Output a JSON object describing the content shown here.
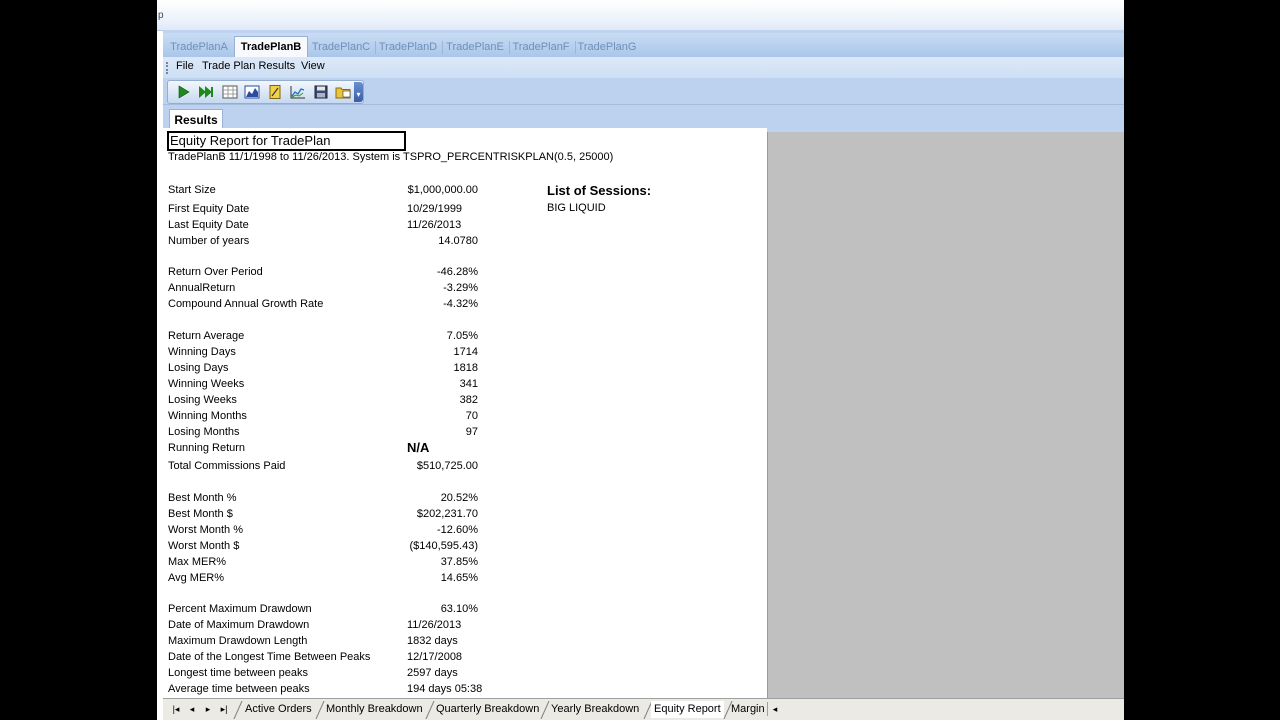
{
  "window": {
    "title_fragment": "p"
  },
  "plan_tabs": [
    {
      "label": "TradePlanA",
      "active": false
    },
    {
      "label": "TradePlanB",
      "active": true
    },
    {
      "label": "TradePlanC",
      "active": false
    },
    {
      "label": "TradePlanD",
      "active": false
    },
    {
      "label": "TradePlanE",
      "active": false
    },
    {
      "label": "TradePlanF",
      "active": false
    },
    {
      "label": "TradePlanG",
      "active": false
    }
  ],
  "menu": [
    "File",
    "Trade Plan Results",
    "View"
  ],
  "toolbar_icons": [
    "play-icon",
    "fast-forward-icon",
    "grid-icon",
    "chart-icon",
    "note-icon",
    "line-chart-icon",
    "save-icon",
    "folder-icon"
  ],
  "results_tab": "Results",
  "report": {
    "title": "Equity Report for TradePlan",
    "subtitle": "TradePlanB 11/1/1998 to 11/26/2013. System is TSPRO_PERCENTRISKPLAN(0.5, 25000)",
    "rows": [
      {
        "label": "Start Size",
        "value": "$1,000,000.00"
      },
      {
        "label": "First Equity Date",
        "value": "10/29/1999"
      },
      {
        "label": "Last Equity Date",
        "value": "11/26/2013"
      },
      {
        "label": "Number of years",
        "value": "14.0780"
      },
      {
        "label": "Return Over Period",
        "value": "-46.28%"
      },
      {
        "label": "AnnualReturn",
        "value": "-3.29%"
      },
      {
        "label": "Compound Annual Growth Rate",
        "value": "-4.32%"
      },
      {
        "label": "Return Average",
        "value": "7.05%"
      },
      {
        "label": "Winning Days",
        "value": "1714"
      },
      {
        "label": "Losing Days",
        "value": "1818"
      },
      {
        "label": "Winning Weeks",
        "value": "341"
      },
      {
        "label": "Losing Weeks",
        "value": "382"
      },
      {
        "label": "Winning Months",
        "value": "70"
      },
      {
        "label": "Losing Months",
        "value": "97"
      },
      {
        "label": "Running Return",
        "value": "N/A"
      },
      {
        "label": "Total Commissions Paid",
        "value": "$510,725.00"
      },
      {
        "label": "Best Month %",
        "value": "20.52%"
      },
      {
        "label": "Best Month $",
        "value": "$202,231.70"
      },
      {
        "label": "Worst Month %",
        "value": "-12.60%"
      },
      {
        "label": "Worst Month $",
        "value": "($140,595.43)"
      },
      {
        "label": "Max MER%",
        "value": "37.85%"
      },
      {
        "label": "Avg MER%",
        "value": "14.65%"
      },
      {
        "label": "Percent Maximum Drawdown",
        "value": "63.10%"
      },
      {
        "label": "Date of Maximum Drawdown",
        "value": "11/26/2013"
      },
      {
        "label": "Maximum Drawdown Length",
        "value": "1832 days"
      },
      {
        "label": "Date of the Longest Time Between Peaks",
        "value": "12/17/2008"
      },
      {
        "label": "Longest time between peaks",
        "value": "2597 days"
      },
      {
        "label": "Average time between peaks",
        "value": "194 days 05:38"
      }
    ],
    "sessions_title": "List of Sessions:",
    "sessions": [
      "BIG LIQUID"
    ]
  },
  "bottom_tabs": [
    {
      "label": "Active Orders",
      "active": false
    },
    {
      "label": "Monthly Breakdown",
      "active": false
    },
    {
      "label": "Quarterly Breakdown",
      "active": false
    },
    {
      "label": "Yearly Breakdown",
      "active": false
    },
    {
      "label": "Equity Report",
      "active": true
    },
    {
      "label": "Margin",
      "active": false
    }
  ]
}
